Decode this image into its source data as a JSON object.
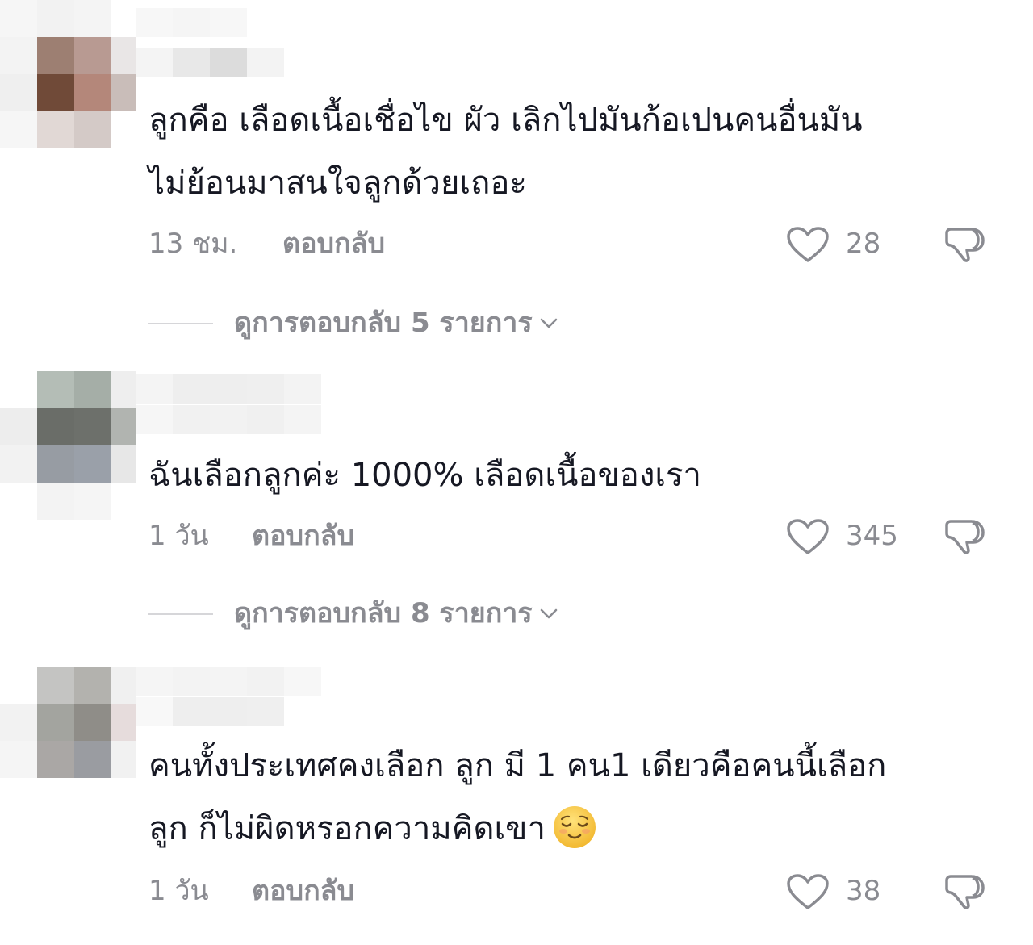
{
  "comments": [
    {
      "text": "ลูกคือ เลือดเนื้อเชื่อไข ผัว เลิกไปมันก้อเปนคนอื่นมัน\nไม่ย้อนมาสนใจลูกด้วยเถอะ",
      "time": "13 ชม.",
      "reply_label": "ตอบกลับ",
      "likes": "28",
      "view_replies": "ดูการตอบกลับ 5 รายการ"
    },
    {
      "text": "ฉันเลือกลูกค่ะ 1000% เลือดเนื้อของเรา",
      "time": "1 วัน",
      "reply_label": "ตอบกลับ",
      "likes": "345",
      "view_replies": "ดูการตอบกลับ 8 รายการ"
    },
    {
      "text": "คนทั้งประเทศคงเลือก ลูก มี 1 คน1 เดียวคือคนนี้เลือก\nลูก ก็ไม่ผิดหรอกความคิดเขา",
      "emoji": "relieved-face",
      "time": "1 วัน",
      "reply_label": "ตอบกลับ",
      "likes": "38"
    }
  ],
  "colors": {
    "text": "#161823",
    "muted": "#8a8b91",
    "emoji_face": "#f7c53d"
  }
}
